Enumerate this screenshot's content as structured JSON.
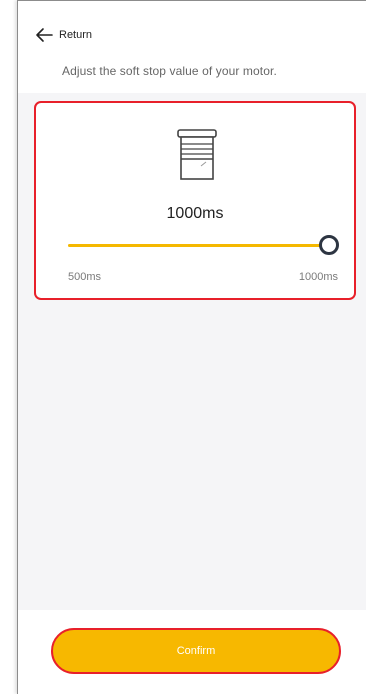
{
  "header": {
    "back_label": "Return",
    "subtitle": "Adjust the soft stop value of your motor."
  },
  "soft_stop": {
    "current_value": "1000ms",
    "min_label": "500ms",
    "max_label": "1000ms",
    "min": 500,
    "max": 1000,
    "value": 1000
  },
  "footer": {
    "confirm_label": "Confirm"
  },
  "colors": {
    "accent": "#f5b800",
    "highlight": "#e8202a",
    "thumb": "#2d3542"
  },
  "icons": {
    "back": "arrow-left-icon",
    "motor": "motor-shutter-icon"
  }
}
